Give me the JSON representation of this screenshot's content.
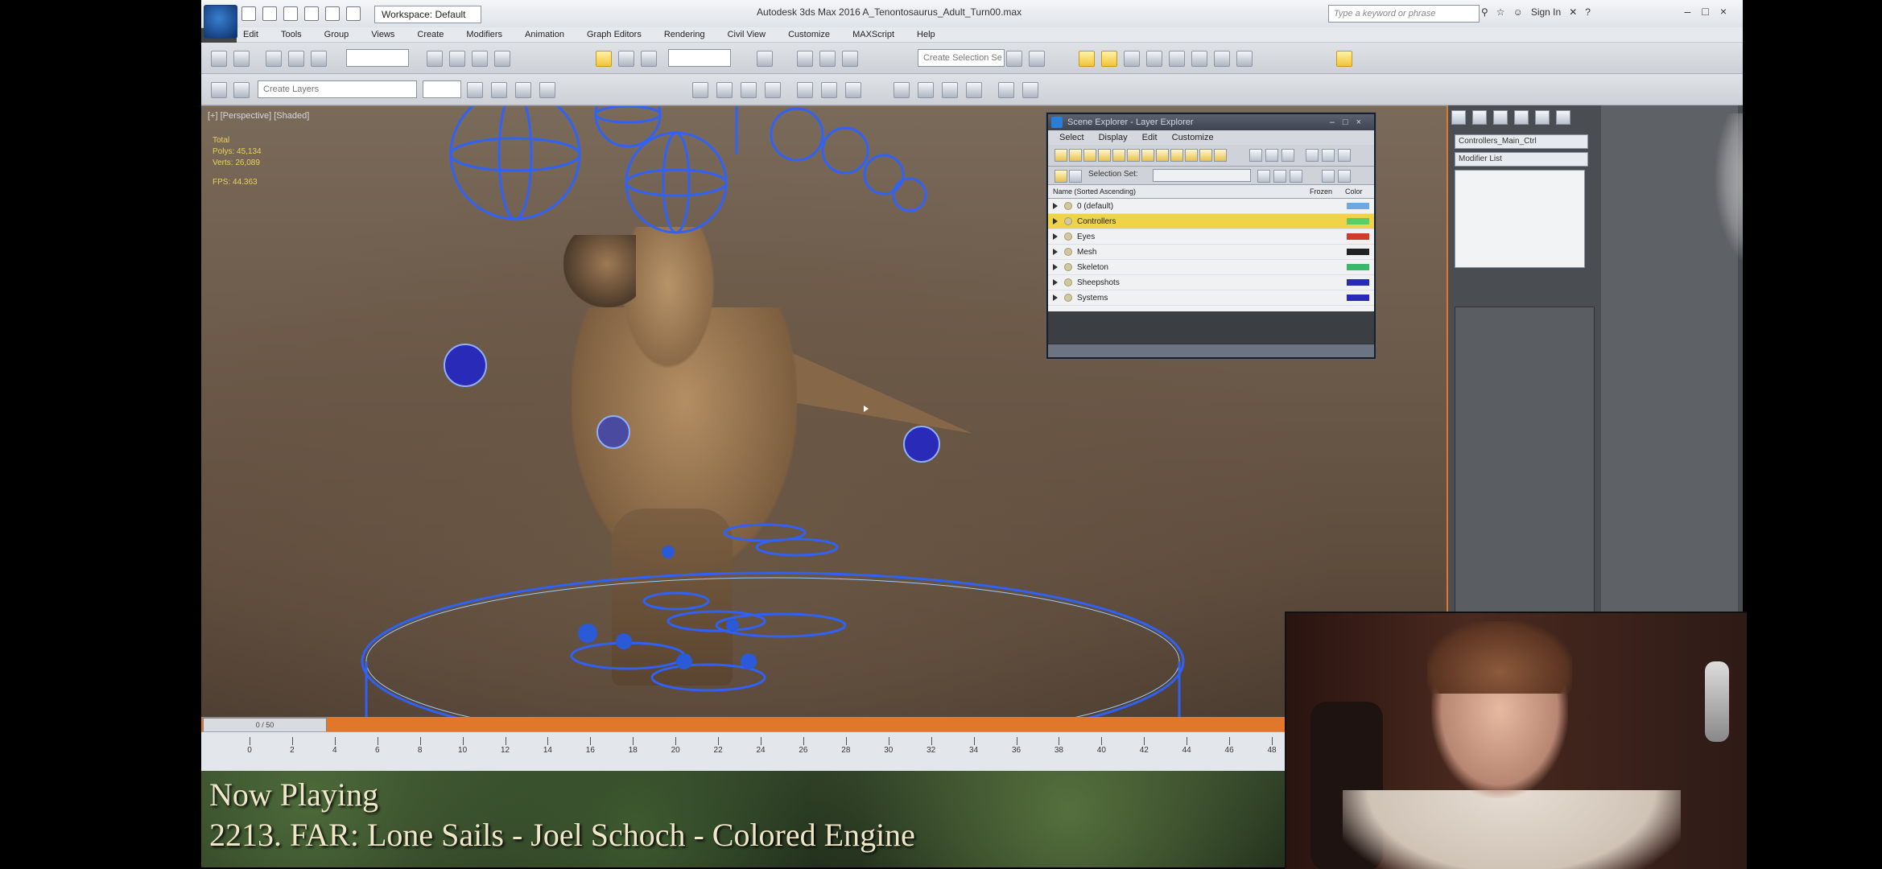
{
  "app": {
    "workspace": "Workspace: Default",
    "window_title": "Autodesk 3ds Max 2016    A_Tenontosaurus_Adult_Turn00.max",
    "search_placeholder": "Type a keyword or phrase",
    "sign_in": "Sign In"
  },
  "menu": [
    "Edit",
    "Tools",
    "Group",
    "Views",
    "Create",
    "Modifiers",
    "Animation",
    "Graph Editors",
    "Rendering",
    "Civil View",
    "Customize",
    "MAXScript",
    "Help"
  ],
  "toolbar": {
    "selection_set_placeholder": "Create Selection Se",
    "layer_field": "Create Layers"
  },
  "viewport": {
    "label": "[+] [Perspective] [Shaded]",
    "stats": [
      "Total",
      "Polys: 45,134",
      "Verts: 26,089",
      "FPS: 44.363"
    ]
  },
  "scene_explorer": {
    "title": "Scene Explorer - Layer Explorer",
    "menu": [
      "Select",
      "Display",
      "Edit",
      "Customize"
    ],
    "selection_set_label": "Selection Set:",
    "columns": {
      "name": "Name (Sorted Ascending)",
      "frozen": "Frozen",
      "color": "Color"
    },
    "rows": [
      {
        "name": "0 (default)",
        "color": "#6fa8e0",
        "selected": false
      },
      {
        "name": "Controllers",
        "color": "#5ccc6a",
        "selected": true
      },
      {
        "name": "Eyes",
        "color": "#d23a2a",
        "selected": false
      },
      {
        "name": "Mesh",
        "color": "#222222",
        "selected": false
      },
      {
        "name": "Skeleton",
        "color": "#3ab86a",
        "selected": false
      },
      {
        "name": "Sheepshots",
        "color": "#2a2ab8",
        "selected": false
      },
      {
        "name": "Systems",
        "color": "#2a2ab8",
        "selected": false
      }
    ]
  },
  "command_panel": {
    "object_name": "Controllers_Main_Ctrl",
    "modifier_list": "Modifier List"
  },
  "timeline": {
    "frame_display": "0 / 50",
    "ticks": [
      "0",
      "2",
      "4",
      "6",
      "8",
      "10",
      "12",
      "14",
      "16",
      "18",
      "20",
      "22",
      "24",
      "26",
      "28",
      "30",
      "32",
      "34",
      "36",
      "38",
      "40",
      "42",
      "44",
      "46",
      "48"
    ]
  },
  "now_playing": {
    "heading": "Now Playing",
    "track": "2213. FAR: Lone Sails - Joel Schoch - Colored Engine"
  }
}
